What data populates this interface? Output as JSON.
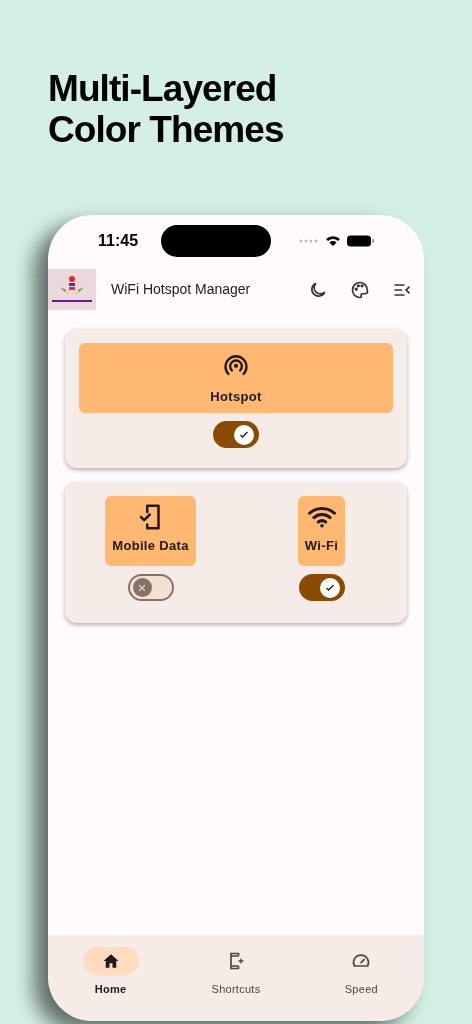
{
  "headline": [
    "Multi-Layered",
    "Color Themes"
  ],
  "status_bar": {
    "time": "11:45"
  },
  "app_bar": {
    "title": "WiFi Hotspot Manager"
  },
  "cards": [
    {
      "tiles": [
        {
          "kind": "hotspot",
          "label": "Hotspot",
          "on": true
        }
      ]
    },
    {
      "tiles": [
        {
          "kind": "mobile",
          "label": "Mobile Data",
          "on": false
        },
        {
          "kind": "wifi",
          "label": "Wi-Fi",
          "on": true
        }
      ]
    }
  ],
  "nav": [
    {
      "kind": "home",
      "label": "Home",
      "selected": true
    },
    {
      "kind": "shortcuts",
      "label": "Shortcuts",
      "selected": false
    },
    {
      "kind": "speed",
      "label": "Speed",
      "selected": false
    }
  ]
}
